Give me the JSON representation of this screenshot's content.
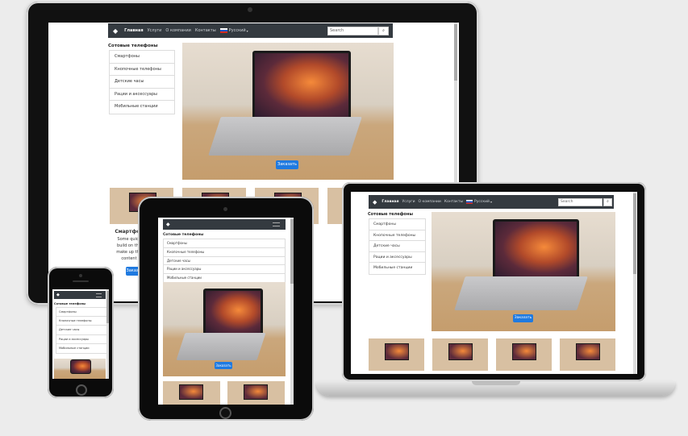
{
  "nav": {
    "logo_icon": "diamond-logo-icon",
    "links": [
      "Главная",
      "Услуги",
      "О компании",
      "Контакты"
    ],
    "language": "Русский",
    "search_placeholder": "Search",
    "search_icon": "search-icon"
  },
  "sidebar": {
    "heading": "Сотовые телефоны",
    "items": [
      "Смартфоны",
      "Кнопочные телефоны",
      "Детские часы",
      "Рации и аксессуары",
      "Мобильные станции"
    ]
  },
  "hero": {
    "button_label": "Заказать"
  },
  "cards": [
    {
      "title": "Смартфон",
      "line1": "Some quick",
      "line2": "build on the",
      "line3": "make up the",
      "line4": "content",
      "button_label": "Заказать"
    }
  ],
  "colors": {
    "navbar": "#343a40",
    "primary": "#1f7ae0",
    "device_frame": "#111111"
  }
}
